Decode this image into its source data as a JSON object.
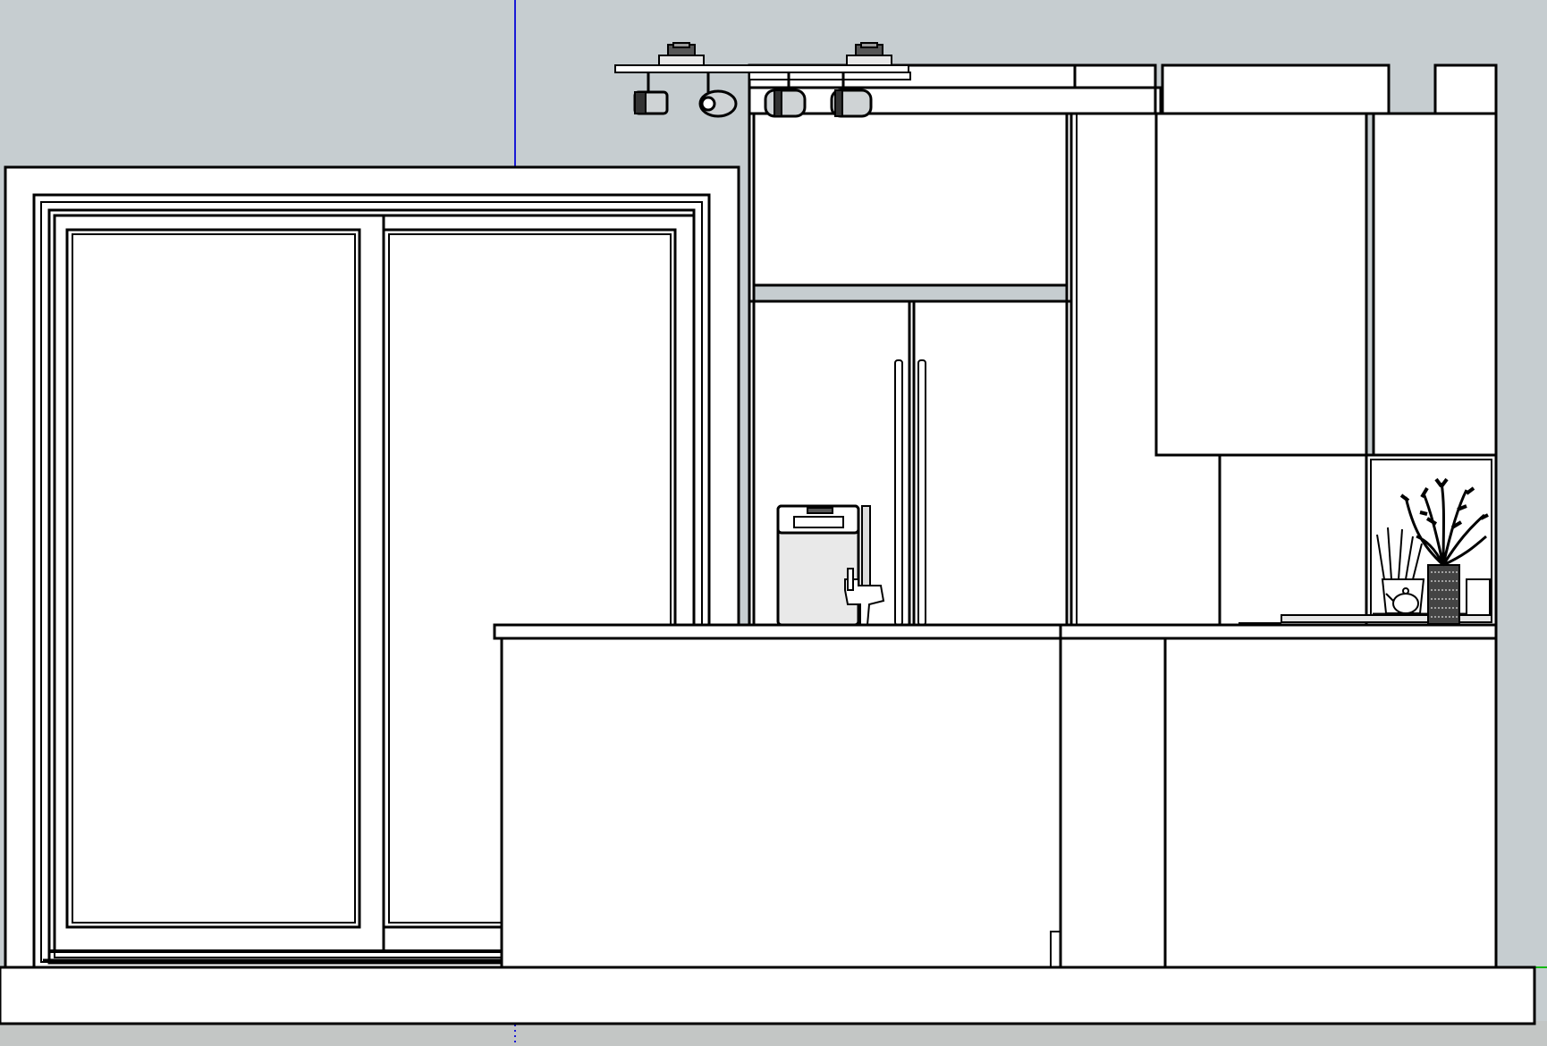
{
  "app": {
    "window_title": "",
    "view": "front-elevation",
    "render_style": "hidden-line"
  },
  "colors": {
    "sky": "#c6cdd0",
    "ground": "#c3c6c5",
    "face": "#ffffff",
    "edge": "#000000",
    "appliance_shade": "#e6e6e6",
    "metal": "#cfd3d5",
    "blue_axis": "#1a1ad6",
    "green_axis": "#14b814"
  },
  "scene": {
    "components": [
      {
        "name": "sliding-patio-door",
        "panels": 2
      },
      {
        "name": "track-light-fixture",
        "spots": 4
      },
      {
        "name": "upper-cabinet"
      },
      {
        "name": "refrigerator",
        "doors": 2
      },
      {
        "name": "coffee-machine",
        "icon": "coffee-machine-icon"
      },
      {
        "name": "kitchen-faucet",
        "icon": "faucet-icon"
      },
      {
        "name": "kitchen-island"
      },
      {
        "name": "tall-pantry-cabinet"
      },
      {
        "name": "wall-cabinets"
      },
      {
        "name": "open-shelf-niche"
      },
      {
        "name": "potted-plant",
        "icon": "plant-icon"
      },
      {
        "name": "utensil-holder",
        "icon": "utensil-icon"
      },
      {
        "name": "teapot",
        "icon": "teapot-icon"
      },
      {
        "name": "floor-slab"
      }
    ],
    "axes": [
      {
        "name": "blue-axis",
        "color": "#1a1ad6"
      },
      {
        "name": "green-axis",
        "color": "#14b814"
      }
    ]
  }
}
